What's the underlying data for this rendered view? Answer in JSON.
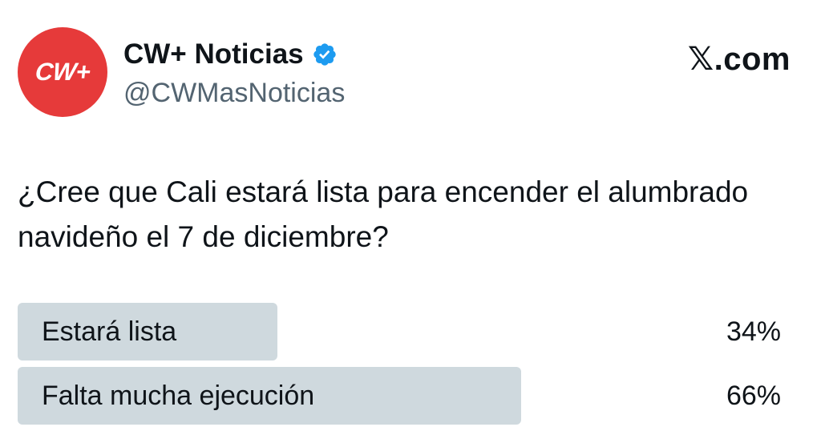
{
  "account": {
    "avatar_text": "CW+",
    "avatar_color": "#e63a3a",
    "display_name": "CW+ Noticias",
    "handle": "@CWMasNoticias",
    "verified": true,
    "verified_color": "#1d9bf0"
  },
  "site": {
    "label": "𝕏.com"
  },
  "post": {
    "question": "¿Cree que Cali estará lista para encender el alumbrado navideño el 7 de diciembre?"
  },
  "poll": {
    "options": [
      {
        "label": "Estará lista",
        "percent_text": "34%",
        "percent": 34
      },
      {
        "label": "Falta mucha ejecución",
        "percent_text": "66%",
        "percent": 66
      }
    ],
    "bar_color": "#cfd9de"
  }
}
